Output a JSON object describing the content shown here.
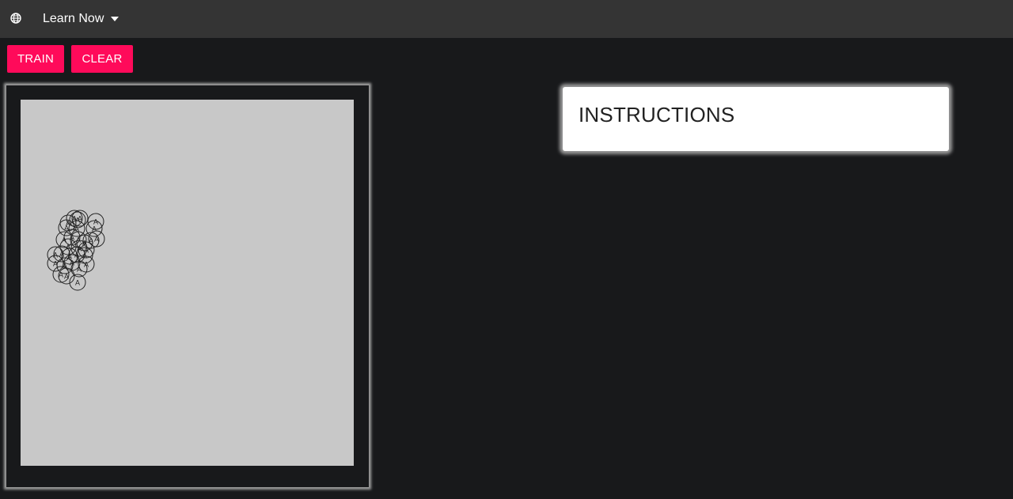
{
  "topbar": {
    "icon": "globe-icon",
    "menu_label": "Learn Now",
    "menu_caret_icon": "caret-down-icon"
  },
  "toolbar": {
    "train_label": "TRAIN",
    "clear_label": "CLEAR"
  },
  "instructions": {
    "title": "INSTRUCTIONS"
  },
  "canvas": {
    "point_label": "A",
    "point_count": 30
  },
  "colors": {
    "topbar": "#343434",
    "background": "#18191b",
    "accent_button": "#ff0a5a",
    "canvas": "#c8c8c8",
    "point_stroke": "#222222"
  }
}
